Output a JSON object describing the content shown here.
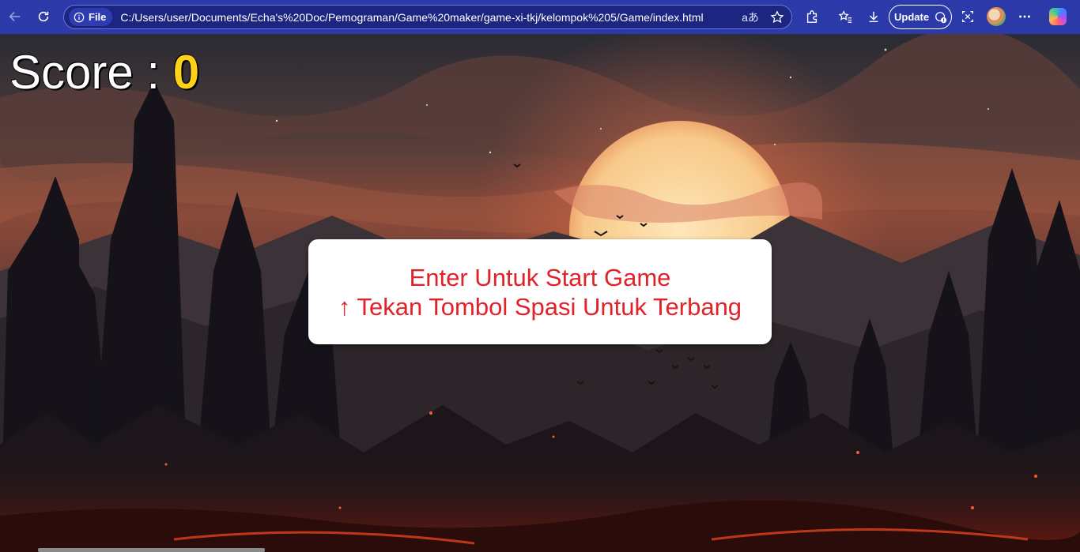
{
  "browser": {
    "site_info_label": "File",
    "url": "C:/Users/user/Documents/Echa's%20Doc/Pemograman/Game%20maker/game-xi-tkj/kelompok%205/Game/index.html",
    "update_label": "Update",
    "read_aloud_glyph": "aあ",
    "toolbar_color": "#2b3aa8"
  },
  "game": {
    "score_label": "Score : ",
    "score_value": "0",
    "instruction_line1": "Enter Untuk Start Game",
    "instruction_line2": "↑ Tekan Tombol Spasi Untuk Terbang",
    "instruction_color": "#e0222a",
    "score_value_color": "#ffd21a"
  }
}
